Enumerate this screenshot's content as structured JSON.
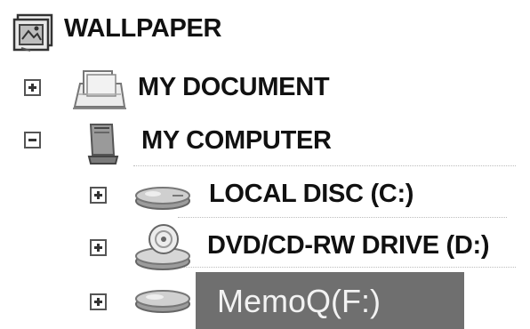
{
  "tree": {
    "root": {
      "label": "WALLPAPER",
      "icon": "wallpaper-desktop-icon"
    },
    "my_document": {
      "label": "MY DOCUMENT",
      "icon": "documents-folder-icon",
      "expander": "plus"
    },
    "my_computer": {
      "label": "MY COMPUTER",
      "icon": "computer-icon",
      "expander": "minus"
    },
    "drives": [
      {
        "label": "LOCAL DISC (C:)",
        "icon": "hard-disk-icon",
        "expander": "plus"
      },
      {
        "label": "DVD/CD-RW DRIVE (D:)",
        "icon": "dvd-drive-icon",
        "expander": "plus"
      },
      {
        "label": "MemoQ(F:)",
        "icon": "removable-disk-icon",
        "expander": "plus",
        "selected": true
      }
    ]
  },
  "colors": {
    "selection_bg": "#6f6f6f",
    "selection_text": "#f2f2f2",
    "text": "#111111"
  }
}
